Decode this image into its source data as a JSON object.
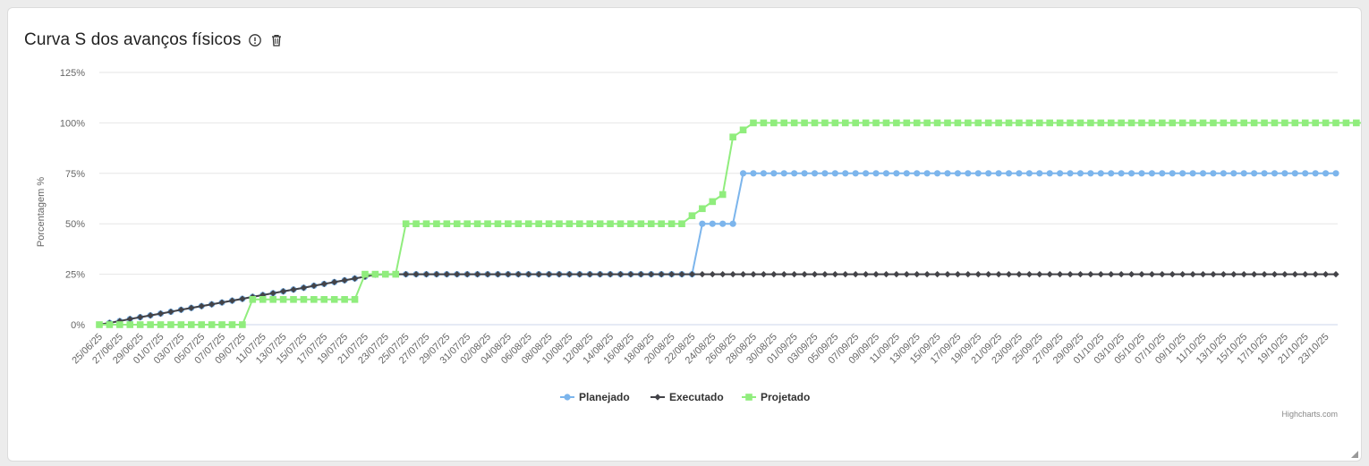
{
  "card": {
    "title": "Curva S dos avanços físicos",
    "icons": [
      "info-circle-icon",
      "trash-icon"
    ]
  },
  "chart_data": {
    "type": "line",
    "title": "",
    "xlabel": "",
    "ylabel": "Porcentagem %",
    "ylim": [
      0,
      125
    ],
    "yticks": [
      "0%",
      "25%",
      "50%",
      "75%",
      "100%",
      "125%"
    ],
    "grid": true,
    "legend_position": "bottom-center",
    "credits": "Highcharts.com",
    "x_start": "25/06/25",
    "x_end": "23/10/25",
    "x_tick_labels": [
      "25/06/25",
      "27/06/25",
      "29/06/25",
      "01/07/25",
      "03/07/25",
      "05/07/25",
      "07/07/25",
      "09/07/25",
      "11/07/25",
      "13/07/25",
      "15/07/25",
      "17/07/25",
      "19/07/25",
      "21/07/25",
      "23/07/25",
      "25/07/25",
      "27/07/25",
      "29/07/25",
      "31/07/25",
      "02/08/25",
      "04/08/25",
      "06/08/25",
      "08/08/25",
      "10/08/25",
      "12/08/25",
      "14/08/25",
      "16/08/25",
      "18/08/25",
      "20/08/25",
      "22/08/25",
      "24/08/25",
      "26/08/25",
      "28/08/25",
      "30/08/25",
      "01/09/25",
      "03/09/25",
      "05/09/25",
      "07/09/25",
      "09/09/25",
      "11/09/25",
      "13/09/25",
      "15/09/25",
      "17/09/25",
      "19/09/25",
      "21/09/25",
      "23/09/25",
      "25/09/25",
      "27/09/25",
      "29/09/25",
      "01/10/25",
      "03/10/25",
      "05/10/25",
      "07/10/25",
      "09/10/25",
      "11/10/25",
      "13/10/25",
      "15/10/25",
      "17/10/25",
      "19/10/25",
      "21/10/25",
      "23/10/25"
    ],
    "series": [
      {
        "name": "Planejado",
        "color": "#7cb5ec",
        "marker": "circle",
        "values": [
          0.0,
          0.9,
          1.8,
          2.8,
          3.7,
          4.6,
          5.5,
          6.4,
          7.4,
          8.3,
          9.2,
          10.1,
          11.0,
          11.9,
          12.8,
          13.8,
          14.7,
          15.6,
          16.5,
          17.4,
          18.3,
          19.3,
          20.2,
          21.1,
          22.0,
          22.9,
          23.8,
          24.8,
          25,
          25,
          25,
          25,
          25,
          25,
          25,
          25,
          25,
          25,
          25,
          25,
          25,
          25,
          25,
          25,
          25,
          25,
          25,
          25,
          25,
          25,
          25,
          25,
          25,
          25,
          25,
          25,
          25,
          25,
          25,
          50,
          50,
          50,
          50,
          75,
          75,
          75,
          75,
          75,
          75,
          75,
          75,
          75,
          75,
          75,
          75,
          75,
          75,
          75,
          75,
          75,
          75,
          75,
          75,
          75,
          75,
          75,
          75,
          75,
          75,
          75,
          75,
          75,
          75,
          75,
          75,
          75,
          75,
          75,
          75,
          75,
          75,
          75,
          75,
          75,
          75,
          75,
          75,
          75,
          75,
          75,
          75,
          75,
          75,
          75,
          75,
          75,
          75,
          75,
          75,
          75,
          75,
          75
        ]
      },
      {
        "name": "Executado",
        "color": "#434348",
        "marker": "diamond",
        "values": [
          0.0,
          0.9,
          1.8,
          2.8,
          3.7,
          4.6,
          5.5,
          6.4,
          7.4,
          8.3,
          9.2,
          10.1,
          11.0,
          11.9,
          12.8,
          13.8,
          14.7,
          15.6,
          16.5,
          17.4,
          18.3,
          19.3,
          20.2,
          21.1,
          22.0,
          22.9,
          23.8,
          24.8,
          25,
          25,
          25,
          25,
          25,
          25,
          25,
          25,
          25,
          25,
          25,
          25,
          25,
          25,
          25,
          25,
          25,
          25,
          25,
          25,
          25,
          25,
          25,
          25,
          25,
          25,
          25,
          25,
          25,
          25,
          25,
          25,
          25,
          25,
          25,
          25,
          25,
          25,
          25,
          25,
          25,
          25,
          25,
          25,
          25,
          25,
          25,
          25,
          25,
          25,
          25,
          25,
          25,
          25,
          25,
          25,
          25,
          25,
          25,
          25,
          25,
          25,
          25,
          25,
          25,
          25,
          25,
          25,
          25,
          25,
          25,
          25,
          25,
          25,
          25,
          25,
          25,
          25,
          25,
          25,
          25,
          25,
          25,
          25,
          25,
          25,
          25,
          25,
          25,
          25,
          25,
          25,
          25,
          25
        ]
      },
      {
        "name": "Projetado",
        "color": "#90ed7d",
        "marker": "square",
        "values": [
          0,
          0,
          0,
          0,
          0,
          0,
          0,
          0,
          0,
          0,
          0,
          0,
          0,
          0,
          0,
          12.5,
          12.5,
          12.5,
          12.5,
          12.5,
          12.5,
          12.5,
          12.5,
          12.5,
          12.5,
          12.5,
          25,
          25,
          25,
          25,
          50,
          50,
          50,
          50,
          50,
          50,
          50,
          50,
          50,
          50,
          50,
          50,
          50,
          50,
          50,
          50,
          50,
          50,
          50,
          50,
          50,
          50,
          50,
          50,
          50,
          50,
          50,
          50,
          54,
          57.5,
          61,
          64.5,
          93,
          96.5,
          100,
          100,
          100,
          100,
          100,
          100,
          100,
          100,
          100,
          100,
          100,
          100,
          100,
          100,
          100,
          100,
          100,
          100,
          100,
          100,
          100,
          100,
          100,
          100,
          100,
          100,
          100,
          100,
          100,
          100,
          100,
          100,
          100,
          100,
          100,
          100,
          100,
          100,
          100,
          100,
          100,
          100,
          100,
          100,
          100,
          100,
          100,
          100,
          100,
          100,
          100,
          100,
          100,
          100,
          100,
          100,
          100,
          100,
          100,
          100,
          100,
          100,
          100,
          100
        ]
      }
    ]
  }
}
